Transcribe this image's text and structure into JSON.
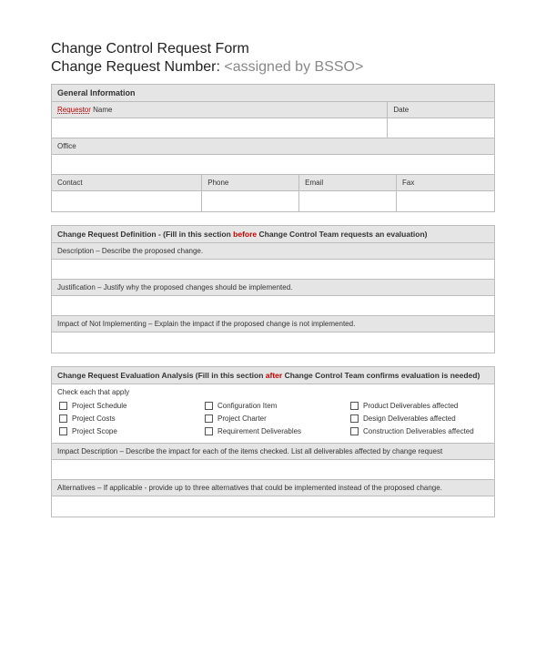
{
  "title": {
    "line1": "Change Control Request Form",
    "line2_label": "Change Request Number:",
    "line2_assigned": "<assigned by BSSO>"
  },
  "general": {
    "header": "General Information",
    "requestor_red": "Requestor",
    "requestor_rest": " Name",
    "date": "Date",
    "office": "Office",
    "contact": "Contact",
    "phone": "Phone",
    "email": "Email",
    "fax": "Fax"
  },
  "definition": {
    "header_pre": "Change Request Definition  -  (Fill in this section ",
    "header_red": "before",
    "header_post": " Change Control Team requests an evaluation)",
    "desc": "Description – Describe the proposed change.",
    "just": "Justification – Justify why the proposed changes should be implemented.",
    "impact": "Impact of Not Implementing – Explain the impact if the proposed change is not implemented."
  },
  "evaluation": {
    "header_pre": "Change Request Evaluation Analysis (Fill in this section ",
    "header_red": "after",
    "header_post": " Change Control Team confirms evaluation is needed)",
    "check_instr": "Check each that apply",
    "items": [
      "Project Schedule",
      "Configuration  Item",
      "Product Deliverables affected",
      "Project Costs",
      "Project Charter",
      "Design Deliverables affected",
      "Project Scope",
      "Requirement Deliverables",
      "Construction Deliverables affected"
    ],
    "impact_desc": "Impact Description – Describe the impact for each of the items checked. List all deliverables affected by change request",
    "alternatives": "Alternatives – If applicable - provide up to three alternatives that could be implemented instead of the proposed change."
  }
}
